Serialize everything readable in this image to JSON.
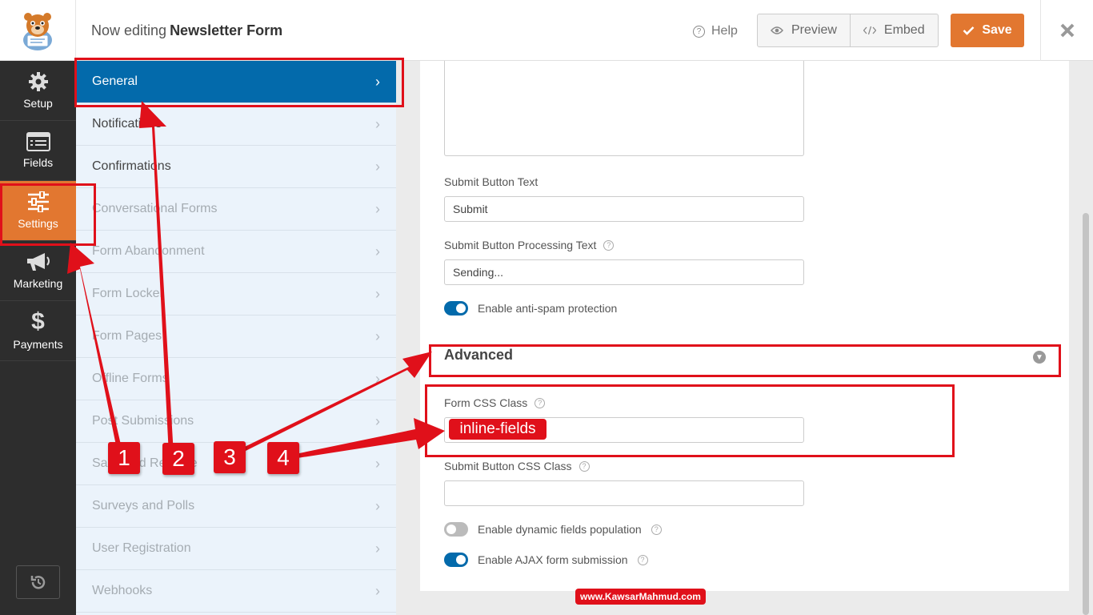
{
  "header": {
    "title_prefix": "Now editing",
    "form_name": "Newsletter Form",
    "help_label": "Help",
    "preview_label": "Preview",
    "embed_label": "Embed",
    "save_label": "Save"
  },
  "sidebar": {
    "items": [
      {
        "label": "Setup",
        "icon": "gear-icon"
      },
      {
        "label": "Fields",
        "icon": "list-icon"
      },
      {
        "label": "Settings",
        "icon": "sliders-icon"
      },
      {
        "label": "Marketing",
        "icon": "megaphone-icon"
      },
      {
        "label": "Payments",
        "icon": "dollar-icon"
      }
    ]
  },
  "settings_menu": {
    "items": [
      {
        "label": "General"
      },
      {
        "label": "Notifications"
      },
      {
        "label": "Confirmations"
      },
      {
        "label": "Conversational Forms"
      },
      {
        "label": "Form Abandonment"
      },
      {
        "label": "Form Locker"
      },
      {
        "label": "Form Pages"
      },
      {
        "label": "Offline Forms"
      },
      {
        "label": "Post Submissions"
      },
      {
        "label": "Save and Resume"
      },
      {
        "label": "Surveys and Polls"
      },
      {
        "label": "User Registration"
      },
      {
        "label": "Webhooks"
      }
    ]
  },
  "form": {
    "submit_text_label": "Submit Button Text",
    "submit_text_value": "Submit",
    "processing_label": "Submit Button Processing Text",
    "processing_value": "Sending...",
    "antispam_label": "Enable anti-spam protection",
    "advanced_title": "Advanced",
    "css_class_label": "Form CSS Class",
    "css_class_value": "inline-fields",
    "submit_css_label": "Submit Button CSS Class",
    "submit_css_value": "",
    "dynamic_label": "Enable dynamic fields population",
    "ajax_label": "Enable AJAX form submission"
  },
  "annotations": {
    "step1": "1",
    "step2": "2",
    "step3": "3",
    "step4": "4",
    "watermark": "www.KawsarMahmud.com"
  },
  "colors": {
    "accent": "#e27730",
    "primary": "#036aab",
    "annotation": "#e0101a"
  }
}
